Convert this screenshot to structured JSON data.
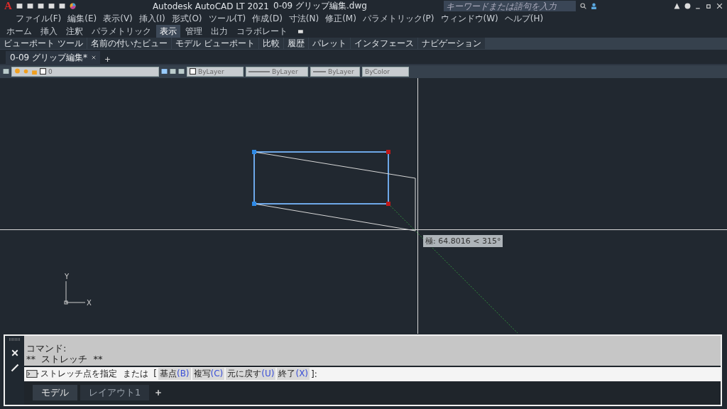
{
  "title_bar": {
    "logo": "A",
    "app": "Autodesk AutoCAD LT 2021",
    "file": "0-09 グリップ編集.dwg",
    "search": {
      "placeholder": "キーワードまたは語句を入力"
    }
  },
  "menu": [
    "ファイル(F)",
    "編集(E)",
    "表示(V)",
    "挿入(I)",
    "形式(O)",
    "ツール(T)",
    "作成(D)",
    "寸法(N)",
    "修正(M)",
    "パラメトリック(P)",
    "ウィンドウ(W)",
    "ヘルプ(H)"
  ],
  "ribbon_tabs": [
    {
      "label": "ホーム",
      "selected": false
    },
    {
      "label": "挿入",
      "selected": false
    },
    {
      "label": "注釈",
      "selected": false
    },
    {
      "label": "パラメトリック",
      "selected": false
    },
    {
      "label": "表示",
      "selected": true
    },
    {
      "label": "管理",
      "selected": false
    },
    {
      "label": "出力",
      "selected": false
    },
    {
      "label": "コラボレート",
      "selected": false
    }
  ],
  "ribbon_panels": [
    "ビューポート ツール",
    "名前の付いたビュー",
    "モデル ビューポート",
    "比較",
    "履歴",
    "パレット",
    "インタフェース",
    "ナビゲーション"
  ],
  "doc_tabs": [
    {
      "label": "0-09 グリップ編集*",
      "selected": true
    }
  ],
  "layer_toolbar": {
    "layer": "0",
    "color_setting": "ByLayer",
    "linetype": "ByLayer",
    "lineweight": "ByLayer",
    "plot_style": "ByColor"
  },
  "canvas": {
    "tooltip": "極: 64.8016 < 315°",
    "ucs": {
      "x": "X",
      "y": "Y"
    }
  },
  "command": {
    "history": [
      "コマンド:",
      "**  ストレッチ  **"
    ],
    "prompt": "ストレッチ点を指定  または  [",
    "options": [
      {
        "label": "基点",
        "key": "(B)"
      },
      {
        "label": "複写",
        "key": "(C)"
      },
      {
        "label": "元に戻す",
        "key": "(U)"
      },
      {
        "label": "終了",
        "key": "(X)"
      }
    ],
    "suffix": "]:"
  },
  "layout_tabs": [
    {
      "label": "モデル",
      "selected": true
    },
    {
      "label": "レイアウト1",
      "selected": false
    }
  ]
}
